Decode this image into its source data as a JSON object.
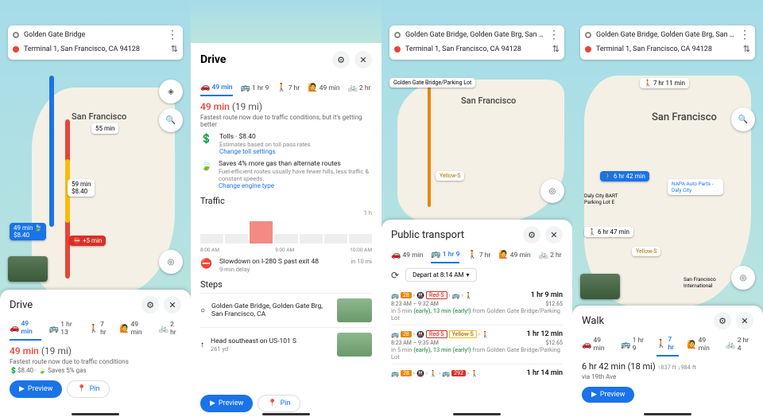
{
  "s1": {
    "from": "Golden Gate Bridge",
    "to": "Terminal 1, San Francisco, CA 94128",
    "city": "San Francisco",
    "chip1": "55 min",
    "chip2_a": "59 min",
    "chip2_b": "$8.40",
    "chip3_a": "49 min",
    "chip3_b": "$8.40",
    "chip_delay": "+5 min",
    "sheet_title": "Drive",
    "tabs": {
      "car": "49 min",
      "transit": "1 hr 13",
      "walk": "7 hr",
      "ride": "49 min",
      "bike": "2 hr"
    },
    "summary_time": "49 min",
    "summary_dist": "(19 mi)",
    "fastest": "Fastest route now due to traffic conditions",
    "toll": "$8.40",
    "eco": "Saves 5% gas",
    "preview": "Preview",
    "pin": "Pin"
  },
  "s2": {
    "title": "Drive",
    "tabs": {
      "car": "49 min",
      "transit": "1 hr 9",
      "walk": "7 hr",
      "ride": "49 min",
      "bike": "2 hr"
    },
    "summary_time": "49 min",
    "summary_dist": "(19 mi)",
    "fastest": "Fastest route now due to traffic conditions, but it's getting better",
    "tolls_title": "Tolls · $8.40",
    "tolls_sub": "Estimates based on toll pass rates",
    "tolls_link": "Change toll settings",
    "eco_title": "Saves 4% more gas than alternate routes",
    "eco_sub": "Fuel-efficient routes usually have fewer hills, less traffic & constant speeds.",
    "eco_link": "Change engine type",
    "traffic": "Traffic",
    "traffic_hint": "1 h",
    "tlabels": [
      "8:00 AM",
      "9:00 AM",
      "10:00 AM"
    ],
    "slowdown": "Slowdown on I-280 S past exit 48",
    "slowdown_sub": "9-min delay",
    "slowdown_time": "in 10 mi",
    "steps": "Steps",
    "step1": "Golden Gate Bridge, Golden Gate Brg, San Francisco, CA",
    "step2": "Head southeast on US-101 S",
    "step2_sub": "261 yd",
    "preview": "Preview",
    "pin": "Pin"
  },
  "s3": {
    "from": "Golden Gate Bridge, Golden Gate Brg, San F…",
    "to": "Terminal 1, San Francisco, CA 94128",
    "city": "San Francisco",
    "loc_label": "Golden Gate Bridge/Parking Lot",
    "yellow": "Yellow-S",
    "sheet_title": "Public transport",
    "tabs": {
      "car": "49 min",
      "transit": "1 hr 9",
      "walk": "7 hr",
      "ride": "49 min",
      "bike": "2 hr"
    },
    "depart": "Depart at 8:14 AM",
    "opt1": {
      "dur": "1 hr 9 min",
      "times": "8:23 AM – 9:32 AM",
      "price": "$12.65",
      "note_a": "in 5 min",
      "note_b": "(early), 13 min",
      "note_c": "(early!)",
      "note_from": " from Golden Gate Bridge/Parking Lot",
      "b28": "28",
      "red": "Red-S"
    },
    "opt2": {
      "dur": "1 hr 12 min",
      "times": "8:23 AM – 9:35 AM",
      "price": "$12.65",
      "note_a": "in 5 min",
      "note_b": "(early), 13 min",
      "note_c": "(early!)",
      "note_from": " from Golden Gate Bridge/Parking Lot",
      "b28": "28",
      "red": "Red-S",
      "yel": "Yellow-S"
    },
    "opt3": {
      "dur": "1 hr 14 min",
      "b28": "28",
      "b292": "292"
    }
  },
  "s4": {
    "from": "Golden Gate Bridge, Golden Gate Brg, San F…",
    "to": "Terminal 1, San Francisco, CA 94128",
    "city": "San Francisco",
    "chip_time": "7 hr 11 min",
    "chip_main": "6 hr 42 min",
    "chip_alt": "6 hr 47 min",
    "poi1": "NAPA Auto Parts - Daly City",
    "poi2": "Daly City BART Parking Lot E",
    "poi3": "San Francisco International",
    "yellow": "Yellow-S",
    "sheet_title": "Walk",
    "tabs": {
      "car": "49 min",
      "transit": "1 hr 9",
      "walk": "7 hr",
      "ride": "49 min",
      "bike": "2 hr 4"
    },
    "summary": "6 hr 42 min (18 mi)",
    "elev_up": "837 ft",
    "elev_down": "984 ft",
    "via": "via 19th Ave",
    "preview": "Preview"
  }
}
